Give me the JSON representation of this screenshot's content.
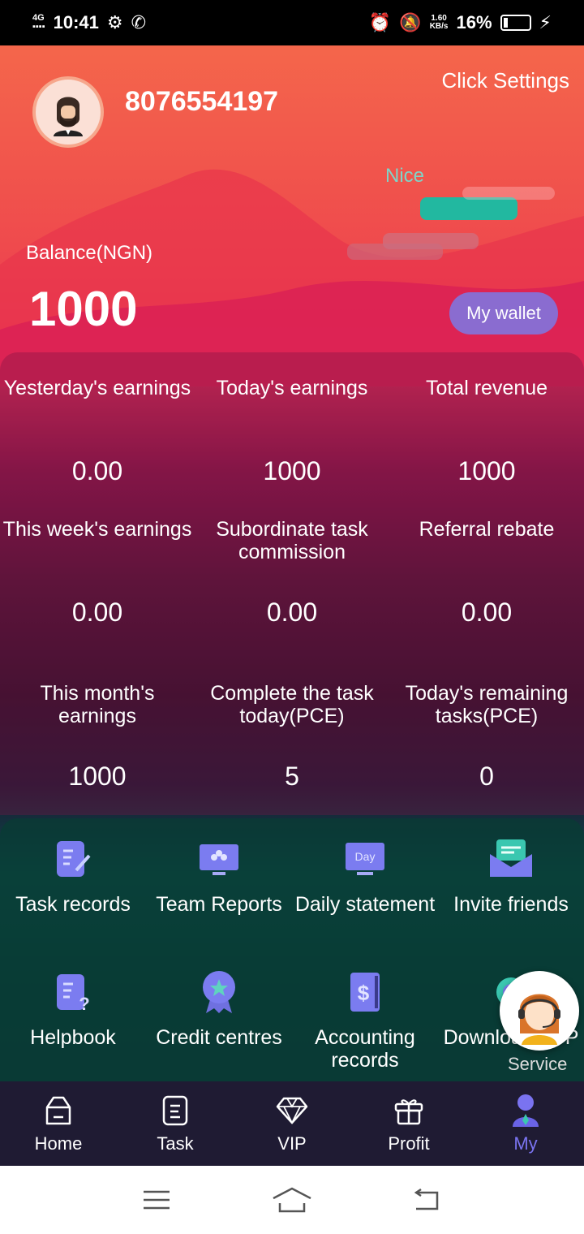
{
  "status_bar": {
    "network": "4G",
    "time": "10:41",
    "speed_top": "1.60",
    "speed_bottom": "KB/s",
    "battery": "16%"
  },
  "header": {
    "phone": "8076554197",
    "settings_label": "Click Settings",
    "nice_label": "Nice",
    "balance_label": "Balance(NGN)",
    "balance_value": "1000",
    "wallet_label": "My wallet"
  },
  "stats": [
    {
      "label": "Yesterday's earnings",
      "value": "0.00"
    },
    {
      "label": "Today's earnings",
      "value": "1000"
    },
    {
      "label": "Total revenue",
      "value": "1000"
    },
    {
      "label": "This week's earnings",
      "value": "0.00"
    },
    {
      "label": "Subordinate task commission",
      "value": "0.00"
    },
    {
      "label": "Referral rebate",
      "value": "0.00"
    },
    {
      "label": "This month's earnings",
      "value": "1000"
    },
    {
      "label": "Complete the task today(PCE)",
      "value": "5"
    },
    {
      "label": "Today's remaining tasks(PCE)",
      "value": "0"
    }
  ],
  "menu": [
    {
      "label": "Task records",
      "icon": "task-records-icon"
    },
    {
      "label": "Team Reports",
      "icon": "team-reports-icon"
    },
    {
      "label": "Daily statement",
      "icon": "daily-statement-icon"
    },
    {
      "label": "Invite friends",
      "icon": "invite-friends-icon"
    },
    {
      "label": "Helpbook",
      "icon": "helpbook-icon"
    },
    {
      "label": "Credit centres",
      "icon": "credit-centres-icon"
    },
    {
      "label": "Accounting records",
      "icon": "accounting-records-icon"
    },
    {
      "label": "Download APP",
      "icon": "download-app-icon"
    }
  ],
  "day_badge": "Day",
  "service_label": "Service",
  "tabs": [
    {
      "label": "Home",
      "active": false
    },
    {
      "label": "Task",
      "active": false
    },
    {
      "label": "VIP",
      "active": false
    },
    {
      "label": "Profit",
      "active": false
    },
    {
      "label": "My",
      "active": true
    }
  ],
  "colors": {
    "accent": "#7a73f0",
    "wallet_button": "#8a6cd0",
    "tabbar": "#1f1b33"
  }
}
